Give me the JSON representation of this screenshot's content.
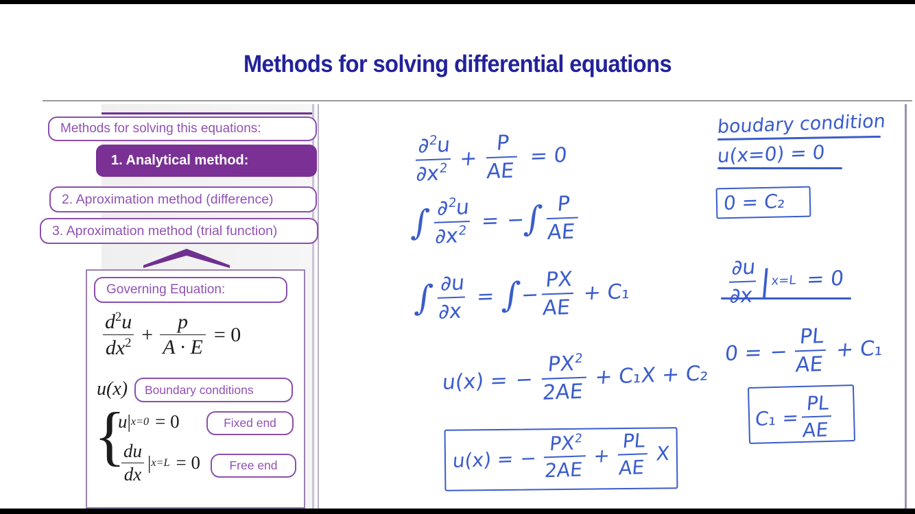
{
  "colors": {
    "title_blue": "#22229a",
    "accent_purple": "#7a3095",
    "outline_purple": "#8b4fae",
    "text_purple": "#9152b4",
    "ink_blue": "#3a5ccc",
    "panel_grey": "#efefef"
  },
  "slide": {
    "title": "Methods for solving differential equations"
  },
  "left_panel": {
    "methods_header": "Methods for solving this equations:",
    "methods": [
      {
        "label": "1. Analytical method:",
        "selected": true
      },
      {
        "label": "2. Aproximation method (difference)",
        "selected": false
      },
      {
        "label": "3. Aproximation method (trial function)",
        "selected": false
      }
    ],
    "chevron_icon": "chevron-up-icon",
    "governing": {
      "header": "Governing Equation:",
      "equation": {
        "frac1_num": "d",
        "frac1_num_exp": "2",
        "frac1_num_var": "u",
        "frac1_den": "dx",
        "frac1_den_exp": "2",
        "plus": "+",
        "frac2_num": "p",
        "frac2_den": "A · E",
        "equals": "= 0"
      },
      "ux_label": "u(x)",
      "boundary_conditions_label": "Boundary conditions",
      "brace": "{",
      "bc1": {
        "var": "u",
        "bar": "|",
        "at": "x=0",
        "rhs": "= 0",
        "tag": "Fixed end"
      },
      "bc2": {
        "num": "du",
        "den": "dx",
        "bar": "|",
        "at": "x=L",
        "rhs": "= 0",
        "tag": "Free end"
      }
    }
  },
  "board": {
    "left_column": [
      {
        "id": "ode",
        "parts": {
          "num": "∂",
          "num_exp": "2",
          "num_var": "u",
          "den": "∂x",
          "den_exp": "2",
          "plus": "+",
          "f2num": "P",
          "f2den": "AE",
          "rhs": "= 0"
        }
      },
      {
        "id": "integrate-twice",
        "parts": {
          "int": "∫",
          "num": "∂",
          "num_exp": "2",
          "num_var": "u",
          "den": "∂x",
          "den_exp": "2",
          "eq": "=",
          "minus": "−",
          "int2": "∫",
          "f2num": "P",
          "f2den": "AE"
        }
      },
      {
        "id": "first-integral",
        "parts": {
          "int": "∫",
          "num": "∂u",
          "den": "∂x",
          "eq": "=",
          "int2": "∫",
          "minus": "−",
          "f2num": "PX",
          "f2den": "AE",
          "tail": "+ C₁"
        }
      },
      {
        "id": "general-solution",
        "parts": {
          "lhs": "u(x) =",
          "minus": "−",
          "num": "PX",
          "num_exp": "2",
          "den": "2AE",
          "tail": "+ C₁X + C₂"
        }
      },
      {
        "id": "final-answer-boxed",
        "boxed": true,
        "parts": {
          "lhs": "u(x) =",
          "minus": "−",
          "num": "PX",
          "num_exp": "2",
          "den": "2AE",
          "plus": "+",
          "f2num": "PL",
          "f2den": "AE",
          "tail": "X"
        }
      }
    ],
    "right_column": [
      {
        "id": "bc-heading",
        "text": "boudary condition",
        "underlined": true
      },
      {
        "id": "bc-first",
        "text": "u(x=0) = 0",
        "underlined": true
      },
      {
        "id": "c2-result",
        "text": "0 = C₂",
        "boxed": true
      },
      {
        "id": "bc-second",
        "parts": {
          "num": "∂u",
          "den": "∂x",
          "bar": "|",
          "at": "x=L",
          "rhs": "= 0"
        },
        "underlined": true
      },
      {
        "id": "c1-equation",
        "parts": {
          "lhs": "0 =",
          "minus": "−",
          "num": "PL",
          "den": "AE",
          "tail": "+ C₁"
        }
      },
      {
        "id": "c1-result",
        "boxed": true,
        "parts": {
          "lhs": "C₁ =",
          "num": "PL",
          "den": "AE"
        }
      }
    ]
  }
}
